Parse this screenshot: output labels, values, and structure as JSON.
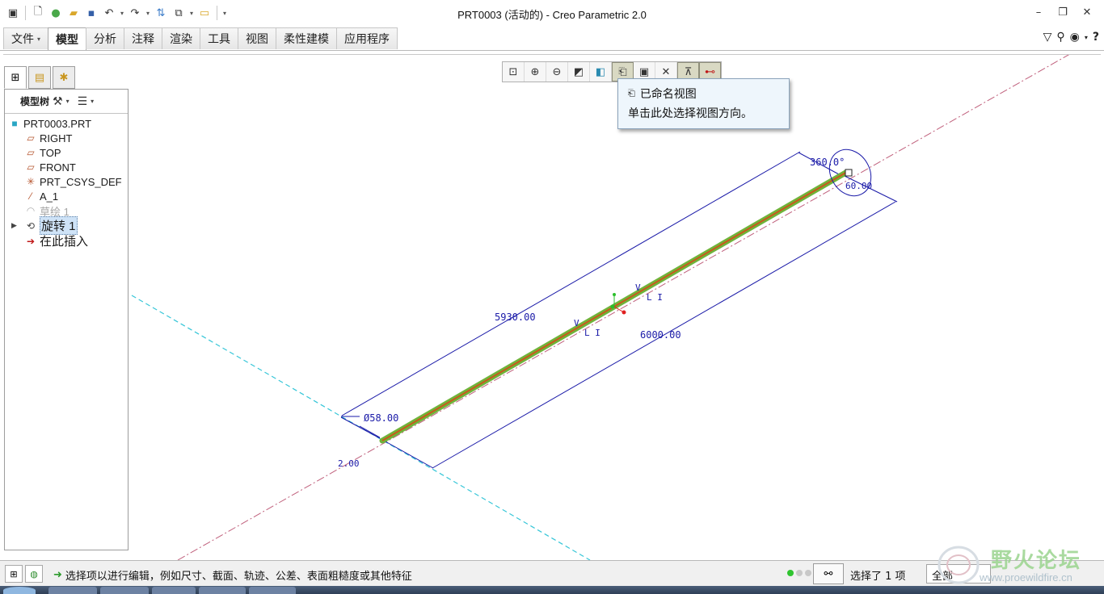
{
  "window": {
    "title": "PRT0003 (活动的) - Creo Parametric 2.0"
  },
  "ribbon": {
    "tabs": [
      {
        "label": "文件"
      },
      {
        "label": "模型"
      },
      {
        "label": "分析"
      },
      {
        "label": "注释"
      },
      {
        "label": "渲染"
      },
      {
        "label": "工具"
      },
      {
        "label": "视图"
      },
      {
        "label": "柔性建模"
      },
      {
        "label": "应用程序"
      }
    ],
    "active_tab": "模型"
  },
  "model_tree": {
    "header_label": "模型树",
    "nodes": [
      {
        "label": "PRT0003.PRT",
        "icon": "part-icon"
      },
      {
        "label": "RIGHT",
        "icon": "datum-plane-icon"
      },
      {
        "label": "TOP",
        "icon": "datum-plane-icon"
      },
      {
        "label": "FRONT",
        "icon": "datum-plane-icon"
      },
      {
        "label": "PRT_CSYS_DEF",
        "icon": "csys-icon"
      },
      {
        "label": "A_1",
        "icon": "datum-axis-icon"
      },
      {
        "label": "草绘 1",
        "icon": "sketch-icon",
        "state": "suppressed"
      },
      {
        "label": "旋转 1",
        "icon": "revolve-icon",
        "state": "selected"
      },
      {
        "label": "在此插入",
        "icon": "insert-here-icon"
      }
    ]
  },
  "tooltip": {
    "title": "已命名视图",
    "description": "单击此处选择视图方向。"
  },
  "dimensions": {
    "length_upper": "5930.00",
    "length_lower": "6000.00",
    "diameter": "Ø58.00",
    "angle": "360.0°",
    "small_left": "2.00",
    "small_right": "60.00"
  },
  "status": {
    "message": "选择项以进行编辑，例如尺寸、截面、轨迹、公差、表面粗糙度或其他特征",
    "selected_count": "选择了 1 项",
    "filter": "全部"
  },
  "watermark": {
    "title": "野火论坛",
    "url": "www.proewildfire.cn"
  },
  "colors": {
    "dimension_blue": "#1a1aa8",
    "axis_cyan": "#36c6d8",
    "datum_dashdot": "#c0607c",
    "shaft_green": "#6fb43a",
    "shaft_orange": "#c85a1e"
  }
}
